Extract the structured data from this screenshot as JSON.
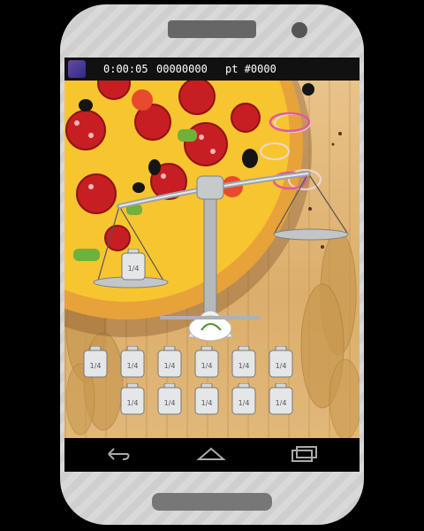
{
  "status": {
    "timer": "0:00:05",
    "score": "00000000",
    "pt": "pt #0000"
  },
  "weights": {
    "row1": [
      "1/4",
      "1/4",
      "1/4",
      "1/4",
      "1/4",
      "1/4"
    ],
    "row2": [
      "1/4",
      "1/4",
      "1/4",
      "1/4",
      "1/4"
    ],
    "pan_left": "1/4"
  },
  "colors": {
    "wood": "#dcae6b",
    "crust": "#e7a23a",
    "cheese": "#f6c530",
    "pepperoni": "#c71e24",
    "status_bar": "#111111"
  },
  "icons": [
    "app-icon",
    "back-icon",
    "home-icon",
    "recent-apps-icon"
  ]
}
